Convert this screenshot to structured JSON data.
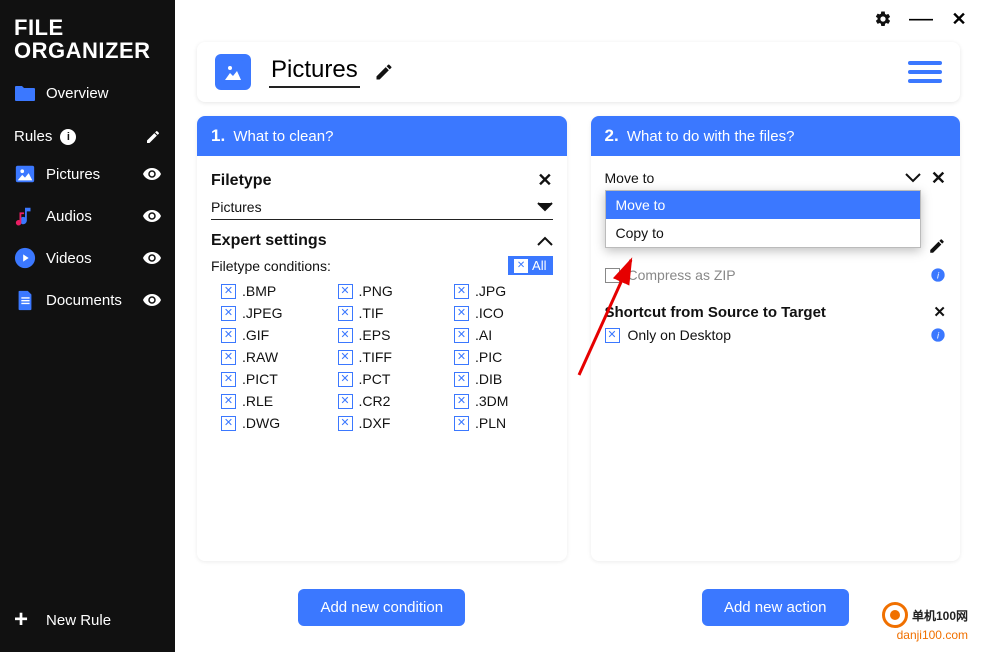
{
  "app_title_line1": "FILE",
  "app_title_line2": "ORGANIZER",
  "sidebar": {
    "overview": "Overview",
    "rules_header": "Rules",
    "items": [
      {
        "label": "Pictures"
      },
      {
        "label": "Audios"
      },
      {
        "label": "Videos"
      },
      {
        "label": "Documents"
      }
    ],
    "new_rule": "New Rule"
  },
  "page": {
    "title": "Pictures"
  },
  "panel1": {
    "number": "1.",
    "header": "What to clean?",
    "filetype_label": "Filetype",
    "filetype_value": "Pictures",
    "expert_label": "Expert settings",
    "conditions_label": "Filetype conditions:",
    "all_label": "All",
    "filetypes": [
      ".BMP",
      ".PNG",
      ".JPG",
      ".JPEG",
      ".TIF",
      ".ICO",
      ".GIF",
      ".EPS",
      ".AI",
      ".RAW",
      ".TIFF",
      ".PIC",
      ".PICT",
      ".PCT",
      ".DIB",
      ".RLE",
      ".CR2",
      ".3DM",
      ".DWG",
      ".DXF",
      ".PLN"
    ],
    "add_btn": "Add new condition"
  },
  "panel2": {
    "number": "2.",
    "header": "What to do with the files?",
    "action_value": "Move to",
    "dropdown": [
      "Move to",
      "Copy to"
    ],
    "hidden_option": "Compress as ZIP",
    "shortcut_label": "Shortcut from Source to Target",
    "only_desktop": "Only on Desktop",
    "add_btn": "Add new action"
  },
  "watermark": {
    "brand": "单机100网",
    "url": "danji100.com"
  }
}
